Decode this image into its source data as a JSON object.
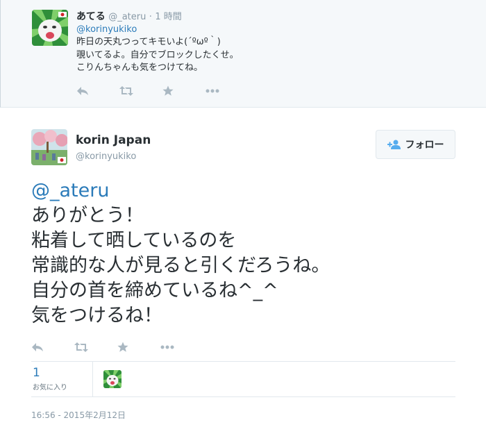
{
  "reply_tweet": {
    "name": "あてる",
    "handle": "@_ateru",
    "separator": "·",
    "time": "1 時間",
    "mention": "@korinyukiko",
    "lines": [
      "昨日の天丸つってキモいよ(´ºωº｀)",
      "覗いてるよ。自分でブロックしたくせ。",
      "こりんちゃんも気をつけてね。"
    ]
  },
  "main_tweet": {
    "fullname": "korin Japan",
    "screenname": "@korinyukiko",
    "follow_label": "フォロー",
    "mention": "@_ateru",
    "lines": [
      "ありがとう！",
      "粘着して晒しているのを",
      "常識的な人が見ると引くだろうね。",
      "自分の首を締めているね^_^",
      "気をつけるね！"
    ],
    "favorites_count": "1",
    "favorites_label": "お気に入り",
    "timestamp": "16:56 - 2015年2月12日"
  },
  "icons": {
    "reply": "reply-icon",
    "retweet": "retweet-icon",
    "favorite": "star-icon",
    "more": "more-icon",
    "follow": "add-user-icon"
  },
  "colors": {
    "link": "#2b7bb9",
    "muted": "#8899a6",
    "action_icon": "#aab8c2",
    "reply_bg": "#f5f8fa"
  }
}
